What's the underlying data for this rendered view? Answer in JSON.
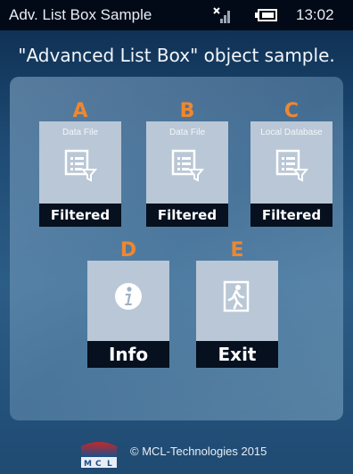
{
  "status_bar": {
    "title": "Adv. List Box Sample",
    "time": "13:02"
  },
  "page_title": "\"Advanced List Box\" object sample.",
  "tiles": [
    {
      "letter": "A",
      "caption": "Data File",
      "label": "Filtered",
      "icon": "filtered-list-icon"
    },
    {
      "letter": "B",
      "caption": "Data File",
      "label": "Filtered",
      "icon": "filtered-list-icon"
    },
    {
      "letter": "C",
      "caption": "Local Database",
      "label": "Filtered",
      "icon": "filtered-list-icon"
    },
    {
      "letter": "D",
      "caption": "",
      "label": "Info",
      "icon": "info-icon"
    },
    {
      "letter": "E",
      "caption": "",
      "label": "Exit",
      "icon": "exit-door-icon"
    }
  ],
  "footer": {
    "logo_text": "MCL",
    "copyright": "© MCL-Technologies  2015"
  },
  "colors": {
    "accent_letter": "#f0872e",
    "status_bar": "#020a17",
    "tile_bar": "#06101e"
  }
}
